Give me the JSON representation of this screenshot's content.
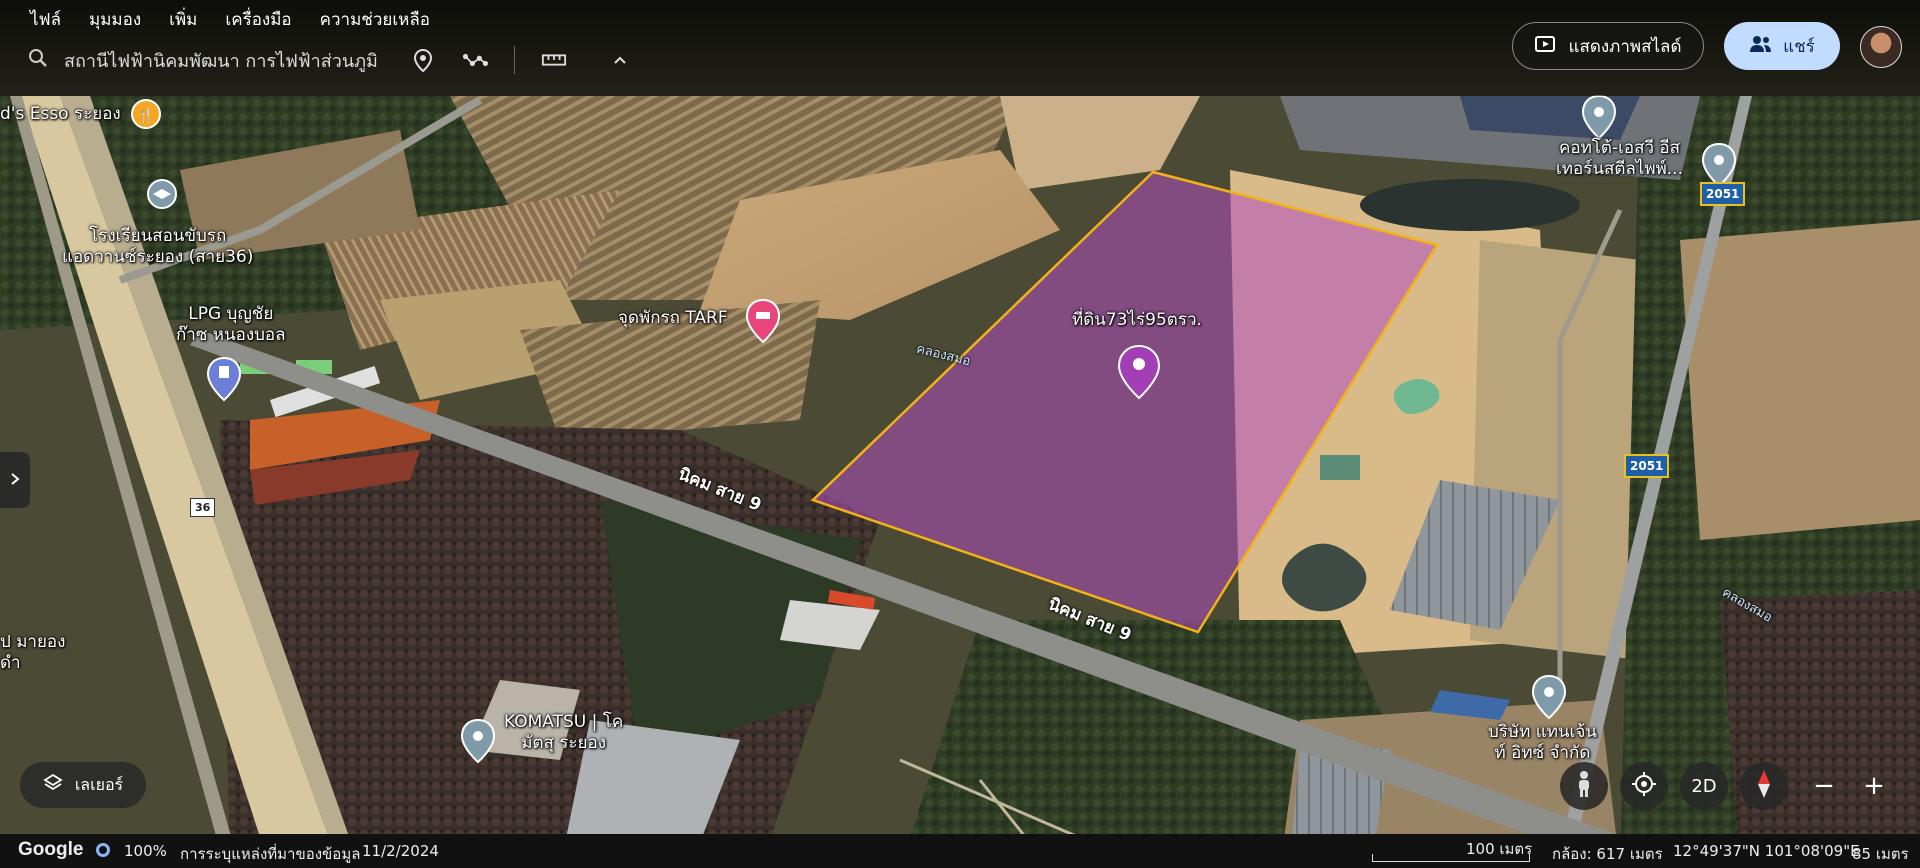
{
  "menu": {
    "items": [
      "ไฟล์",
      "มุมมอง",
      "เพิ่ม",
      "เครื่องมือ",
      "ความช่วยเหลือ"
    ]
  },
  "search": {
    "value": "สถานีไฟฟ้านิคมพัฒนา การไฟฟ้าส่วนภูมิ"
  },
  "header": {
    "slideshow_label": "แสดงภาพสไลด์",
    "share_label": "แชร์"
  },
  "map": {
    "places": {
      "esso": "d's Esso ระยอง",
      "school": "โรงเรียนสอนขับรถ\nแอดวานซ์ระยอง (สาย36)",
      "lpg": "LPG บุญชัย\nก๊าซ หนองบอล",
      "tarf": "จุดพักรถ TARF",
      "land": "ที่ดิน73ไร่95ตรว.",
      "cotto": "คอทโต้-เอสวี อีส\nเทอร์นสตีลไพพ์...",
      "komatsu": "KOMATSU | โค\nมัตสุ ระยอง",
      "tanjent": "บริษัท แทนเจ้น\nท์ อิทซ์ จำกัด",
      "left_edge": "ป มายอง\nดำ"
    },
    "roads": {
      "road9_a": "นิคม สาย 9",
      "road9_b": "นิคม สาย 9"
    },
    "waterways": {
      "canal_a": "คลองสมอ",
      "canal_b": "คลองสมอ"
    },
    "shields": {
      "r2051_top": "2051",
      "r2051_mid": "2051",
      "r36": "36"
    },
    "colors": {
      "parcel_fill": "#b04fc0",
      "parcel_border": "#f2b316",
      "pin": "#a23fb5"
    }
  },
  "controls": {
    "layers_label": "เลเยอร์",
    "view_2d_label": "2D",
    "zoom_out_label": "−",
    "zoom_in_label": "+"
  },
  "status": {
    "logo": "Google",
    "progress": "100%",
    "attribution": "การระบุแหล่งที่มาของข้อมูล",
    "date": "11/2/2024",
    "scale": "100 เมตร",
    "camera": "กล้อง: 617 เมตร",
    "coords": "12°49'37\"N 101°08'09\"E",
    "elevation": "85 เมตร"
  }
}
